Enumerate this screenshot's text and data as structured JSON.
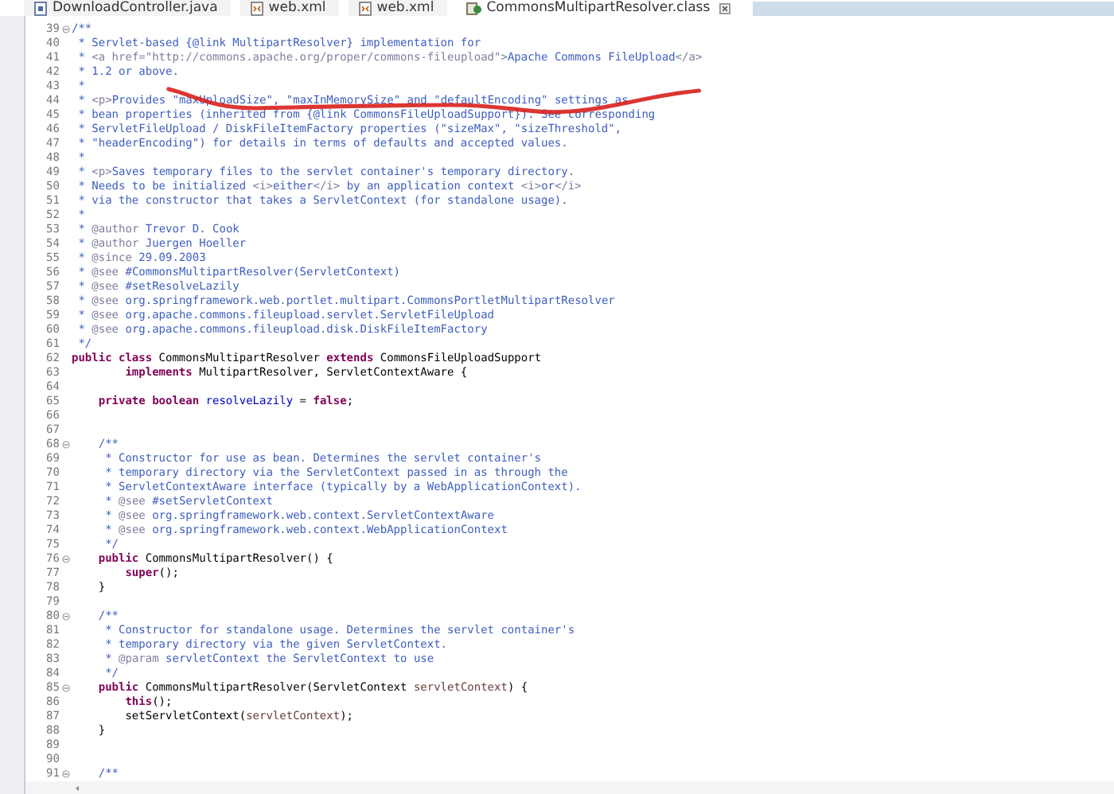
{
  "tabs": [
    {
      "label": "DownloadController.java",
      "kind": "java",
      "selected": false
    },
    {
      "label": "web.xml",
      "kind": "xml",
      "selected": false
    },
    {
      "label": "web.xml",
      "kind": "xml",
      "selected": false
    },
    {
      "label": "CommonsMultipartResolver.class",
      "kind": "class",
      "selected": true
    }
  ],
  "lines": [
    {
      "number": "39",
      "fold": true,
      "segments": [
        {
          "kind": "comment",
          "text": "/**"
        }
      ]
    },
    {
      "number": "40",
      "fold": false,
      "segments": [
        {
          "kind": "comment",
          "text": " * Servlet-based {@link MultipartResolver} implementation for"
        }
      ]
    },
    {
      "number": "41",
      "fold": false,
      "segments": [
        {
          "kind": "comment",
          "text": " * "
        },
        {
          "kind": "tag",
          "text": "<a href=\"http://commons.apache.org/proper/commons-fileupload\">"
        },
        {
          "kind": "comment",
          "text": "Apache Commons FileUpload"
        },
        {
          "kind": "tag",
          "text": "</a>"
        }
      ]
    },
    {
      "number": "42",
      "fold": false,
      "segments": [
        {
          "kind": "comment",
          "text": " * 1.2 or above."
        }
      ]
    },
    {
      "number": "43",
      "fold": false,
      "segments": [
        {
          "kind": "comment",
          "text": " *"
        }
      ]
    },
    {
      "number": "44",
      "fold": false,
      "segments": [
        {
          "kind": "comment",
          "text": " * "
        },
        {
          "kind": "tag",
          "text": "<p>"
        },
        {
          "kind": "comment",
          "text": "Provides \"maxUploadSize\", \"maxInMemorySize\" and \"defaultEncoding\" settings as"
        }
      ]
    },
    {
      "number": "45",
      "fold": false,
      "segments": [
        {
          "kind": "comment",
          "text": " * bean properties (inherited from {@link CommonsFileUploadSupport}). See corresponding"
        }
      ]
    },
    {
      "number": "46",
      "fold": false,
      "segments": [
        {
          "kind": "comment",
          "text": " * ServletFileUpload / DiskFileItemFactory properties (\"sizeMax\", \"sizeThreshold\","
        }
      ]
    },
    {
      "number": "47",
      "fold": false,
      "segments": [
        {
          "kind": "comment",
          "text": " * \"headerEncoding\") for details in terms of defaults and accepted values."
        }
      ]
    },
    {
      "number": "48",
      "fold": false,
      "segments": [
        {
          "kind": "comment",
          "text": " *"
        }
      ]
    },
    {
      "number": "49",
      "fold": false,
      "segments": [
        {
          "kind": "comment",
          "text": " * "
        },
        {
          "kind": "tag",
          "text": "<p>"
        },
        {
          "kind": "comment",
          "text": "Saves temporary files to the servlet container's temporary directory."
        }
      ]
    },
    {
      "number": "50",
      "fold": false,
      "segments": [
        {
          "kind": "comment",
          "text": " * Needs to be initialized "
        },
        {
          "kind": "tag",
          "text": "<i>"
        },
        {
          "kind": "comment",
          "text": "either"
        },
        {
          "kind": "tag",
          "text": "</i>"
        },
        {
          "kind": "comment",
          "text": " by an application context "
        },
        {
          "kind": "tag",
          "text": "<i>"
        },
        {
          "kind": "comment",
          "text": "or"
        },
        {
          "kind": "tag",
          "text": "</i>"
        }
      ]
    },
    {
      "number": "51",
      "fold": false,
      "segments": [
        {
          "kind": "comment",
          "text": " * via the constructor that takes a ServletContext (for standalone usage)."
        }
      ]
    },
    {
      "number": "52",
      "fold": false,
      "segments": [
        {
          "kind": "comment",
          "text": " *"
        }
      ]
    },
    {
      "number": "53",
      "fold": false,
      "segments": [
        {
          "kind": "comment",
          "text": " * "
        },
        {
          "kind": "tag",
          "text": "@author"
        },
        {
          "kind": "comment",
          "text": " Trevor D. Cook"
        }
      ]
    },
    {
      "number": "54",
      "fold": false,
      "segments": [
        {
          "kind": "comment",
          "text": " * "
        },
        {
          "kind": "tag",
          "text": "@author"
        },
        {
          "kind": "comment",
          "text": " Juergen Hoeller"
        }
      ]
    },
    {
      "number": "55",
      "fold": false,
      "segments": [
        {
          "kind": "comment",
          "text": " * "
        },
        {
          "kind": "tag",
          "text": "@since"
        },
        {
          "kind": "comment",
          "text": " 29.09.2003"
        }
      ]
    },
    {
      "number": "56",
      "fold": false,
      "segments": [
        {
          "kind": "comment",
          "text": " * "
        },
        {
          "kind": "tag",
          "text": "@see"
        },
        {
          "kind": "comment",
          "text": " #CommonsMultipartResolver(ServletContext)"
        }
      ]
    },
    {
      "number": "57",
      "fold": false,
      "segments": [
        {
          "kind": "comment",
          "text": " * "
        },
        {
          "kind": "tag",
          "text": "@see"
        },
        {
          "kind": "comment",
          "text": " #setResolveLazily"
        }
      ]
    },
    {
      "number": "58",
      "fold": false,
      "segments": [
        {
          "kind": "comment",
          "text": " * "
        },
        {
          "kind": "tag",
          "text": "@see"
        },
        {
          "kind": "comment",
          "text": " org.springframework.web.portlet.multipart.CommonsPortletMultipartResolver"
        }
      ]
    },
    {
      "number": "59",
      "fold": false,
      "segments": [
        {
          "kind": "comment",
          "text": " * "
        },
        {
          "kind": "tag",
          "text": "@see"
        },
        {
          "kind": "comment",
          "text": " org.apache.commons.fileupload.servlet.ServletFileUpload"
        }
      ]
    },
    {
      "number": "60",
      "fold": false,
      "segments": [
        {
          "kind": "comment",
          "text": " * "
        },
        {
          "kind": "tag",
          "text": "@see"
        },
        {
          "kind": "comment",
          "text": " org.apache.commons.fileupload.disk.DiskFileItemFactory"
        }
      ]
    },
    {
      "number": "61",
      "fold": false,
      "segments": [
        {
          "kind": "comment",
          "text": " */"
        }
      ]
    },
    {
      "number": "62",
      "fold": false,
      "segments": [
        {
          "kind": "keyword",
          "text": "public class"
        },
        {
          "kind": "code",
          "text": " CommonsMultipartResolver "
        },
        {
          "kind": "keyword",
          "text": "extends"
        },
        {
          "kind": "code",
          "text": " CommonsFileUploadSupport"
        }
      ]
    },
    {
      "number": "63",
      "fold": false,
      "segments": [
        {
          "kind": "keyword",
          "text": "        implements"
        },
        {
          "kind": "code",
          "text": " MultipartResolver, ServletContextAware {"
        }
      ]
    },
    {
      "number": "64",
      "fold": false
    },
    {
      "number": "65",
      "fold": false,
      "segments": [
        {
          "kind": "keyword",
          "text": "    private boolean"
        },
        {
          "kind": "field",
          "text": " resolveLazily"
        },
        {
          "kind": "code",
          "text": " = "
        },
        {
          "kind": "keyword",
          "text": "false"
        },
        {
          "kind": "code",
          "text": ";"
        }
      ]
    },
    {
      "number": "66",
      "fold": false
    },
    {
      "number": "67",
      "fold": false
    },
    {
      "number": "68",
      "fold": true,
      "segments": [
        {
          "kind": "comment",
          "text": "    /**"
        }
      ]
    },
    {
      "number": "69",
      "fold": false,
      "segments": [
        {
          "kind": "comment",
          "text": "     * Constructor for use as bean. Determines the servlet container's"
        }
      ]
    },
    {
      "number": "70",
      "fold": false,
      "segments": [
        {
          "kind": "comment",
          "text": "     * temporary directory via the ServletContext passed in as through the"
        }
      ]
    },
    {
      "number": "71",
      "fold": false,
      "segments": [
        {
          "kind": "comment",
          "text": "     * ServletContextAware interface (typically by a WebApplicationContext)."
        }
      ]
    },
    {
      "number": "72",
      "fold": false,
      "segments": [
        {
          "kind": "comment",
          "text": "     * "
        },
        {
          "kind": "tag",
          "text": "@see"
        },
        {
          "kind": "comment",
          "text": " #setServletContext"
        }
      ]
    },
    {
      "number": "73",
      "fold": false,
      "segments": [
        {
          "kind": "comment",
          "text": "     * "
        },
        {
          "kind": "tag",
          "text": "@see"
        },
        {
          "kind": "comment",
          "text": " org.springframework.web.context.ServletContextAware"
        }
      ]
    },
    {
      "number": "74",
      "fold": false,
      "segments": [
        {
          "kind": "comment",
          "text": "     * "
        },
        {
          "kind": "tag",
          "text": "@see"
        },
        {
          "kind": "comment",
          "text": " org.springframework.web.context.WebApplicationContext"
        }
      ]
    },
    {
      "number": "75",
      "fold": false,
      "segments": [
        {
          "kind": "comment",
          "text": "     */"
        }
      ]
    },
    {
      "number": "76",
      "fold": true,
      "segments": [
        {
          "kind": "keyword",
          "text": "    public"
        },
        {
          "kind": "code",
          "text": " CommonsMultipartResolver() {"
        }
      ]
    },
    {
      "number": "77",
      "fold": false,
      "segments": [
        {
          "kind": "keyword",
          "text": "        super"
        },
        {
          "kind": "code",
          "text": "();"
        }
      ]
    },
    {
      "number": "78",
      "fold": false,
      "segments": [
        {
          "kind": "code",
          "text": "    }"
        }
      ]
    },
    {
      "number": "79",
      "fold": false
    },
    {
      "number": "80",
      "fold": true,
      "segments": [
        {
          "kind": "comment",
          "text": "    /**"
        }
      ]
    },
    {
      "number": "81",
      "fold": false,
      "segments": [
        {
          "kind": "comment",
          "text": "     * Constructor for standalone usage. Determines the servlet container's"
        }
      ]
    },
    {
      "number": "82",
      "fold": false,
      "segments": [
        {
          "kind": "comment",
          "text": "     * temporary directory via the given ServletContext."
        }
      ]
    },
    {
      "number": "83",
      "fold": false,
      "segments": [
        {
          "kind": "comment",
          "text": "     * "
        },
        {
          "kind": "tag",
          "text": "@param"
        },
        {
          "kind": "comment",
          "text": " servletContext the ServletContext to use"
        }
      ]
    },
    {
      "number": "84",
      "fold": false,
      "segments": [
        {
          "kind": "comment",
          "text": "     */"
        }
      ]
    },
    {
      "number": "85",
      "fold": true,
      "segments": [
        {
          "kind": "keyword",
          "text": "    public"
        },
        {
          "kind": "code",
          "text": " CommonsMultipartResolver(ServletContext "
        },
        {
          "kind": "param",
          "text": "servletContext"
        },
        {
          "kind": "code",
          "text": ") {"
        }
      ]
    },
    {
      "number": "86",
      "fold": false,
      "segments": [
        {
          "kind": "keyword",
          "text": "        this"
        },
        {
          "kind": "code",
          "text": "();"
        }
      ]
    },
    {
      "number": "87",
      "fold": false,
      "segments": [
        {
          "kind": "code",
          "text": "        setServletContext("
        },
        {
          "kind": "param",
          "text": "servletContext"
        },
        {
          "kind": "code",
          "text": ");"
        }
      ]
    },
    {
      "number": "88",
      "fold": false,
      "segments": [
        {
          "kind": "code",
          "text": "    }"
        }
      ]
    },
    {
      "number": "89",
      "fold": false
    },
    {
      "number": "90",
      "fold": false
    },
    {
      "number": "91",
      "fold": true,
      "segments": [
        {
          "kind": "comment",
          "text": "    /**"
        }
      ]
    }
  ]
}
